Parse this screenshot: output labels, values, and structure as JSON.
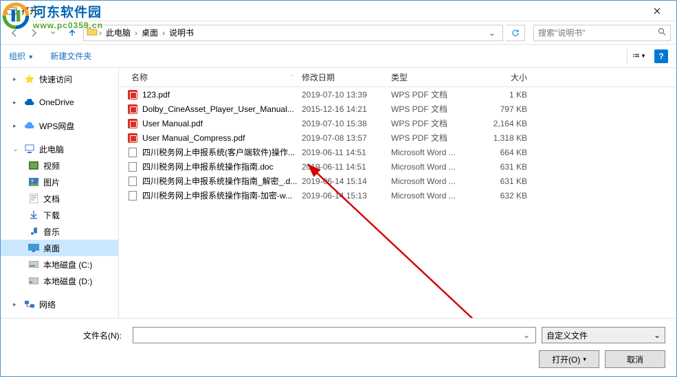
{
  "watermark": {
    "cn": "河东软件园",
    "url": "www.pc0359.cn"
  },
  "titlebar": {
    "title": "打开"
  },
  "nav": {
    "crumbs": [
      "此电脑",
      "桌面",
      "说明书"
    ],
    "search_placeholder": "搜索\"说明书\""
  },
  "toolbar": {
    "organize": "组织",
    "newfolder": "新建文件夹"
  },
  "sidebar": {
    "quick": "快速访问",
    "onedrive": "OneDrive",
    "wps": "WPS网盘",
    "thispc": "此电脑",
    "video": "视频",
    "pictures": "图片",
    "documents": "文档",
    "downloads": "下载",
    "music": "音乐",
    "desktop": "桌面",
    "diskc": "本地磁盘 (C:)",
    "diskd": "本地磁盘 (D:)",
    "network": "网络"
  },
  "columns": {
    "name": "名称",
    "date": "修改日期",
    "type": "类型",
    "size": "大小"
  },
  "files": [
    {
      "icon": "pdf",
      "name": "123.pdf",
      "date": "2019-07-10 13:39",
      "type": "WPS PDF 文档",
      "size": "1 KB"
    },
    {
      "icon": "pdf",
      "name": "Dolby_CineAsset_Player_User_Manual...",
      "date": "2015-12-16 14:21",
      "type": "WPS PDF 文档",
      "size": "797 KB"
    },
    {
      "icon": "pdf",
      "name": "User Manual.pdf",
      "date": "2019-07-10 15:38",
      "type": "WPS PDF 文档",
      "size": "2,164 KB"
    },
    {
      "icon": "pdf",
      "name": "User Manual_Compress.pdf",
      "date": "2019-07-08 13:57",
      "type": "WPS PDF 文档",
      "size": "1,318 KB"
    },
    {
      "icon": "doc",
      "name": "四川税务网上申报系统(客户端软件)操作...",
      "date": "2019-06-11 14:51",
      "type": "Microsoft Word ...",
      "size": "664 KB"
    },
    {
      "icon": "doc",
      "name": "四川税务网上申报系统操作指南.doc",
      "date": "2019-06-11 14:51",
      "type": "Microsoft Word ...",
      "size": "631 KB"
    },
    {
      "icon": "doc",
      "name": "四川税务网上申报系统操作指南_解密_.d...",
      "date": "2019-06-14 15:14",
      "type": "Microsoft Word ...",
      "size": "631 KB"
    },
    {
      "icon": "doc",
      "name": "四川税务网上申报系统操作指南-加密-w...",
      "date": "2019-06-14 15:13",
      "type": "Microsoft Word ...",
      "size": "632 KB"
    }
  ],
  "footer": {
    "filename_label": "文件名(N):",
    "filter": "自定义文件",
    "open": "打开(O)",
    "cancel": "取消"
  }
}
